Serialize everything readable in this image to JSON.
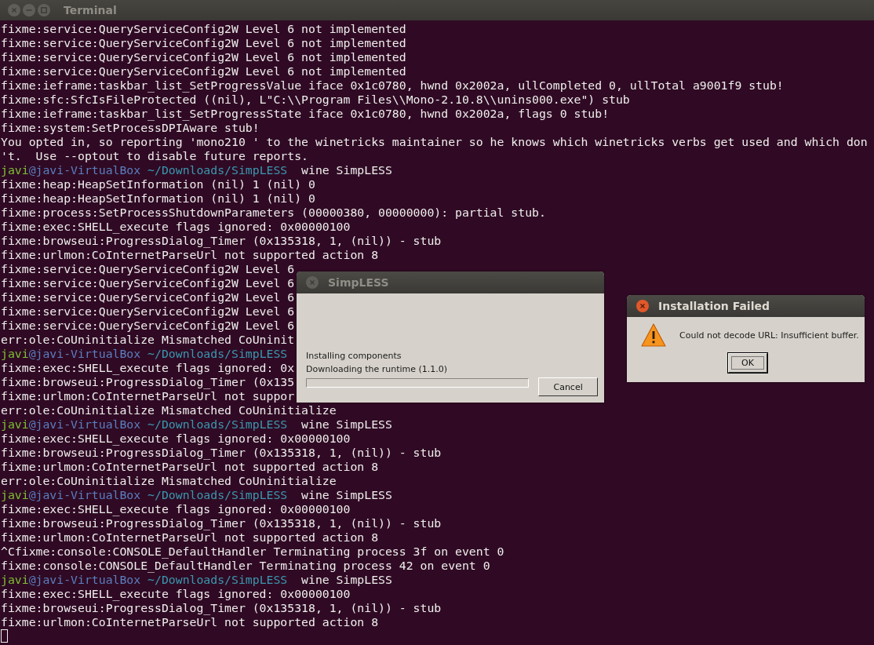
{
  "window": {
    "title": "Terminal"
  },
  "terminal": {
    "lines": [
      {
        "kind": "output",
        "text": "fixme:service:QueryServiceConfig2W Level 6 not implemented"
      },
      {
        "kind": "output",
        "text": "fixme:service:QueryServiceConfig2W Level 6 not implemented"
      },
      {
        "kind": "output",
        "text": "fixme:service:QueryServiceConfig2W Level 6 not implemented"
      },
      {
        "kind": "output",
        "text": "fixme:service:QueryServiceConfig2W Level 6 not implemented"
      },
      {
        "kind": "output",
        "text": "fixme:ieframe:taskbar_list_SetProgressValue iface 0x1c0780, hwnd 0x2002a, ullCompleted 0, ullTotal a9001f9 stub!"
      },
      {
        "kind": "output",
        "text": "fixme:sfc:SfcIsFileProtected ((nil), L\"C:\\\\Program Files\\\\Mono-2.10.8\\\\unins000.exe\") stub"
      },
      {
        "kind": "output",
        "text": "fixme:ieframe:taskbar_list_SetProgressState iface 0x1c0780, hwnd 0x2002a, flags 0 stub!"
      },
      {
        "kind": "output",
        "text": "fixme:system:SetProcessDPIAware stub!"
      },
      {
        "kind": "output",
        "text": "You opted in, so reporting 'mono210 ' to the winetricks maintainer so he knows which winetricks verbs get used and which don"
      },
      {
        "kind": "output",
        "text": "'t.  Use --optout to disable future reports."
      },
      {
        "kind": "prompt",
        "user": "javi",
        "host": "@javi-VirtualBox",
        "path": "~/Downloads/SimpLESS",
        "command": "wine SimpLESS"
      },
      {
        "kind": "output",
        "text": "fixme:heap:HeapSetInformation (nil) 1 (nil) 0"
      },
      {
        "kind": "output",
        "text": "fixme:heap:HeapSetInformation (nil) 1 (nil) 0"
      },
      {
        "kind": "output",
        "text": "fixme:process:SetProcessShutdownParameters (00000380, 00000000): partial stub."
      },
      {
        "kind": "output",
        "text": "fixme:exec:SHELL_execute flags ignored: 0x00000100"
      },
      {
        "kind": "output",
        "text": "fixme:browseui:ProgressDialog_Timer (0x135318, 1, (nil)) - stub"
      },
      {
        "kind": "output",
        "text": "fixme:urlmon:CoInternetParseUrl not supported action 8"
      },
      {
        "kind": "output",
        "text": "fixme:service:QueryServiceConfig2W Level 6"
      },
      {
        "kind": "output",
        "text": "fixme:service:QueryServiceConfig2W Level 6"
      },
      {
        "kind": "output",
        "text": "fixme:service:QueryServiceConfig2W Level 6"
      },
      {
        "kind": "output",
        "text": "fixme:service:QueryServiceConfig2W Level 6"
      },
      {
        "kind": "output",
        "text": "fixme:service:QueryServiceConfig2W Level 6"
      },
      {
        "kind": "output",
        "text": "err:ole:CoUninitialize Mismatched CoUninit"
      },
      {
        "kind": "prompt",
        "user": "javi",
        "host": "@javi-VirtualBox",
        "path": "~/Downloads/SimpLESS"
      },
      {
        "kind": "output",
        "text": "fixme:exec:SHELL_execute flags ignored: 0x"
      },
      {
        "kind": "output",
        "text": "fixme:browseui:ProgressDialog_Timer (0x135"
      },
      {
        "kind": "output",
        "text": "fixme:urlmon:CoInternetParseUrl not suppor"
      },
      {
        "kind": "output",
        "text": "err:ole:CoUninitialize Mismatched CoUninitialize"
      },
      {
        "kind": "prompt",
        "user": "javi",
        "host": "@javi-VirtualBox",
        "path": "~/Downloads/SimpLESS",
        "command": "wine SimpLESS"
      },
      {
        "kind": "output",
        "text": "fixme:exec:SHELL_execute flags ignored: 0x00000100"
      },
      {
        "kind": "output",
        "text": "fixme:browseui:ProgressDialog_Timer (0x135318, 1, (nil)) - stub"
      },
      {
        "kind": "output",
        "text": "fixme:urlmon:CoInternetParseUrl not supported action 8"
      },
      {
        "kind": "output",
        "text": "err:ole:CoUninitialize Mismatched CoUninitialize"
      },
      {
        "kind": "prompt",
        "user": "javi",
        "host": "@javi-VirtualBox",
        "path": "~/Downloads/SimpLESS",
        "command": "wine SimpLESS"
      },
      {
        "kind": "output",
        "text": "fixme:exec:SHELL_execute flags ignored: 0x00000100"
      },
      {
        "kind": "output",
        "text": "fixme:browseui:ProgressDialog_Timer (0x135318, 1, (nil)) - stub"
      },
      {
        "kind": "output",
        "text": "fixme:urlmon:CoInternetParseUrl not supported action 8"
      },
      {
        "kind": "output",
        "text": "^Cfixme:console:CONSOLE_DefaultHandler Terminating process 3f on event 0"
      },
      {
        "kind": "output",
        "text": "fixme:console:CONSOLE_DefaultHandler Terminating process 42 on event 0"
      },
      {
        "kind": "prompt",
        "user": "javi",
        "host": "@javi-VirtualBox",
        "path": "~/Downloads/SimpLESS",
        "command": "wine SimpLESS"
      },
      {
        "kind": "output",
        "text": "fixme:exec:SHELL_execute flags ignored: 0x00000100"
      },
      {
        "kind": "output",
        "text": "fixme:browseui:ProgressDialog_Timer (0x135318, 1, (nil)) - stub"
      },
      {
        "kind": "output",
        "text": "fixme:urlmon:CoInternetParseUrl not supported action 8"
      }
    ]
  },
  "dialogs": [
    {
      "kind": "progress",
      "title": "SimpLESS",
      "status": "Installing components",
      "detail": "Downloading the  runtime (1.1.0)",
      "level": 0,
      "button": "Cancel"
    },
    {
      "kind": "alert",
      "title": "Installation Failed",
      "message": "Could not decode URL: Insufficient buffer.",
      "button": "OK"
    }
  ]
}
